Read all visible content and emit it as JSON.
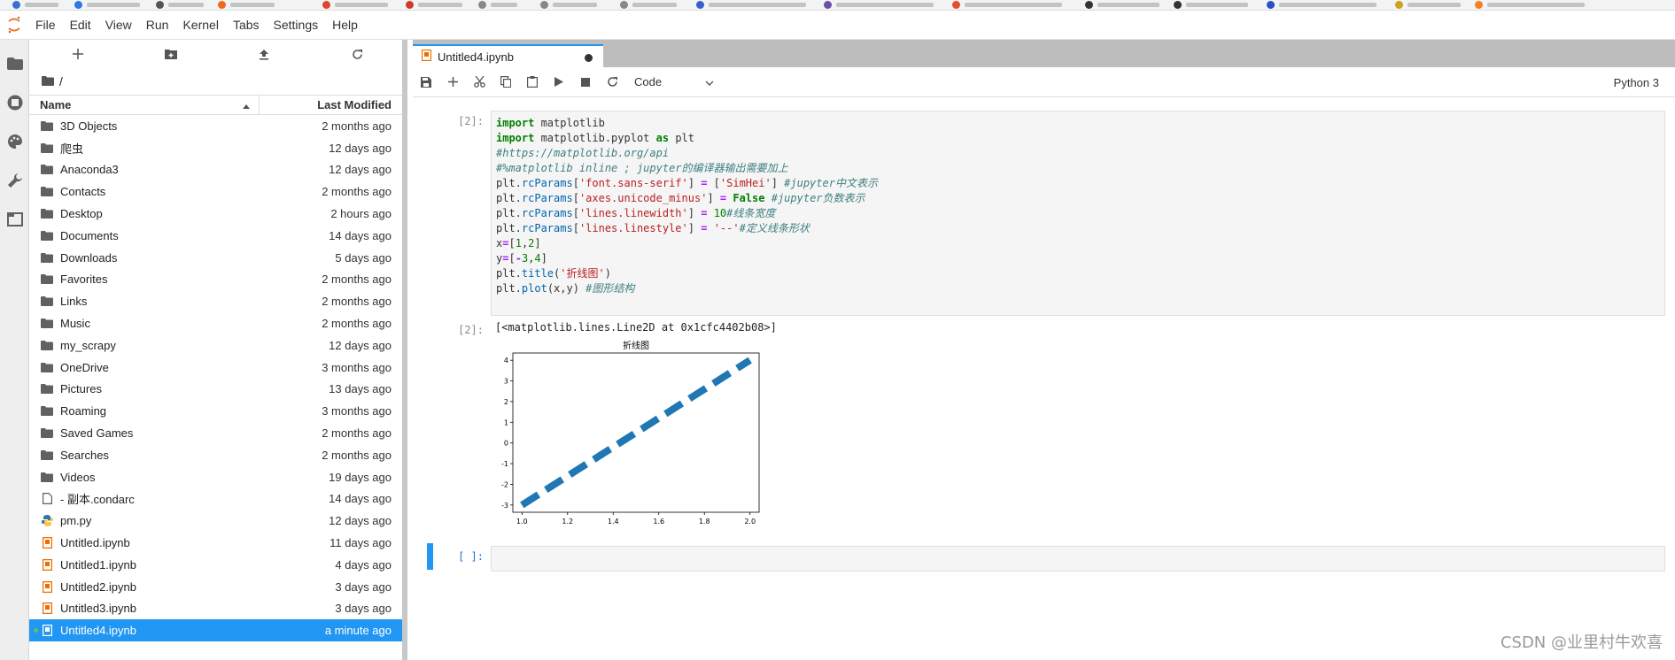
{
  "menubar": {
    "items": [
      "File",
      "Edit",
      "View",
      "Run",
      "Kernel",
      "Tabs",
      "Settings",
      "Help"
    ]
  },
  "activity_bar": {
    "icons": [
      "folder-icon",
      "running-icon",
      "palette-icon",
      "wrench-icon",
      "tabs-icon"
    ]
  },
  "file_browser": {
    "path": "/",
    "columns": {
      "name": "Name",
      "modified": "Last Modified"
    },
    "files": [
      {
        "name": "3D Objects",
        "modified": "2 months ago",
        "type": "folder"
      },
      {
        "name": "爬虫",
        "modified": "12 days ago",
        "type": "folder"
      },
      {
        "name": "Anaconda3",
        "modified": "12 days ago",
        "type": "folder"
      },
      {
        "name": "Contacts",
        "modified": "2 months ago",
        "type": "folder"
      },
      {
        "name": "Desktop",
        "modified": "2 hours ago",
        "type": "folder"
      },
      {
        "name": "Documents",
        "modified": "14 days ago",
        "type": "folder"
      },
      {
        "name": "Downloads",
        "modified": "5 days ago",
        "type": "folder"
      },
      {
        "name": "Favorites",
        "modified": "2 months ago",
        "type": "folder"
      },
      {
        "name": "Links",
        "modified": "2 months ago",
        "type": "folder"
      },
      {
        "name": "Music",
        "modified": "2 months ago",
        "type": "folder"
      },
      {
        "name": "my_scrapy",
        "modified": "12 days ago",
        "type": "folder"
      },
      {
        "name": "OneDrive",
        "modified": "3 months ago",
        "type": "folder"
      },
      {
        "name": "Pictures",
        "modified": "13 days ago",
        "type": "folder"
      },
      {
        "name": "Roaming",
        "modified": "3 months ago",
        "type": "folder"
      },
      {
        "name": "Saved Games",
        "modified": "2 months ago",
        "type": "folder"
      },
      {
        "name": "Searches",
        "modified": "2 months ago",
        "type": "folder"
      },
      {
        "name": "Videos",
        "modified": "19 days ago",
        "type": "folder"
      },
      {
        "name": "- 副本.condarc",
        "modified": "14 days ago",
        "type": "file"
      },
      {
        "name": "pm.py",
        "modified": "12 days ago",
        "type": "python"
      },
      {
        "name": "Untitled.ipynb",
        "modified": "11 days ago",
        "type": "notebook"
      },
      {
        "name": "Untitled1.ipynb",
        "modified": "4 days ago",
        "type": "notebook"
      },
      {
        "name": "Untitled2.ipynb",
        "modified": "3 days ago",
        "type": "notebook"
      },
      {
        "name": "Untitled3.ipynb",
        "modified": "3 days ago",
        "type": "notebook"
      },
      {
        "name": "Untitled4.ipynb",
        "modified": "a minute ago",
        "type": "notebook",
        "selected": true
      }
    ]
  },
  "tab": {
    "title": "Untitled4.ipynb"
  },
  "notebook_toolbar": {
    "cell_type": "Code",
    "kernel": "Python 3"
  },
  "cells": {
    "input_prompt": "[2]:",
    "output_prompt": "[2]:",
    "empty_prompt": "[ ]:",
    "output_text": "[<matplotlib.lines.Line2D at 0x1cfc4402b08>]"
  },
  "chart_data": {
    "type": "line",
    "title": "折线图",
    "x": [
      1,
      2
    ],
    "series": [
      {
        "values": [
          -3,
          4
        ]
      }
    ],
    "xlim": [
      0.96,
      2.04
    ],
    "ylim": [
      -3.35,
      4.35
    ],
    "xticks": [
      "1.0",
      "1.2",
      "1.4",
      "1.6",
      "1.8",
      "2.0"
    ],
    "yticks": [
      "-3",
      "-2",
      "-1",
      "0",
      "1",
      "2",
      "3",
      "4"
    ],
    "line_style": "dashed",
    "color": "#1f77b4",
    "grid": false
  },
  "watermark": "CSDN @业里村牛欢喜"
}
